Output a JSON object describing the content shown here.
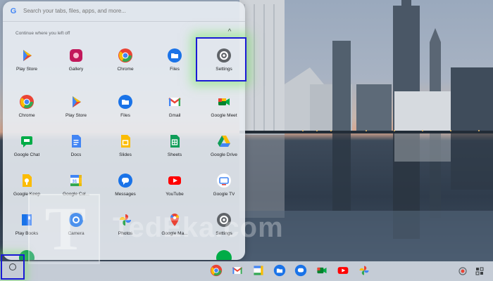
{
  "search": {
    "placeholder": "Search your tabs, files, apps, and more..."
  },
  "continue_section": {
    "title": "Continue where you left off"
  },
  "recent_apps": [
    {
      "label": "Play Store",
      "icon": "play-store-icon"
    },
    {
      "label": "Gallery",
      "icon": "gallery-icon"
    },
    {
      "label": "Chrome",
      "icon": "chrome-icon"
    },
    {
      "label": "Files",
      "icon": "files-icon"
    },
    {
      "label": "Settings",
      "icon": "settings-icon"
    }
  ],
  "app_grid": [
    [
      {
        "label": "Chrome",
        "icon": "chrome-icon"
      },
      {
        "label": "Play Store",
        "icon": "play-store-icon"
      },
      {
        "label": "Files",
        "icon": "files-icon"
      },
      {
        "label": "Gmail",
        "icon": "gmail-icon"
      },
      {
        "label": "Google Meet",
        "icon": "google-meet-icon"
      }
    ],
    [
      {
        "label": "Google Chat",
        "icon": "google-chat-icon"
      },
      {
        "label": "Docs",
        "icon": "docs-icon"
      },
      {
        "label": "Slides",
        "icon": "slides-icon"
      },
      {
        "label": "Sheets",
        "icon": "sheets-icon"
      },
      {
        "label": "Google Drive",
        "icon": "google-drive-icon"
      }
    ],
    [
      {
        "label": "Google Keep",
        "icon": "google-keep-icon"
      },
      {
        "label": "Google Cal...",
        "icon": "google-calendar-icon"
      },
      {
        "label": "Messages",
        "icon": "messages-icon"
      },
      {
        "label": "YouTube",
        "icon": "youtube-icon"
      },
      {
        "label": "Google TV",
        "icon": "google-tv-icon"
      }
    ],
    [
      {
        "label": "Play Books",
        "icon": "play-books-icon"
      },
      {
        "label": "Camera",
        "icon": "camera-icon"
      },
      {
        "label": "Photos",
        "icon": "photos-icon"
      },
      {
        "label": "Google Ma...",
        "icon": "google-maps-icon"
      },
      {
        "label": "Settings",
        "icon": "settings-icon"
      }
    ]
  ],
  "watermark": {
    "letter": "T",
    "text": "TedEka.com"
  },
  "shelf": {
    "pinned_apps": [
      "chrome-icon",
      "gmail-icon",
      "google-calendar-icon",
      "files-icon",
      "messages-icon",
      "google-meet-icon",
      "youtube-icon",
      "photos-icon"
    ]
  },
  "colors": {
    "highlight_border": "#1a1ad6",
    "highlight_glow": "#78e664",
    "launcher_bg": "#e8ecf2"
  }
}
